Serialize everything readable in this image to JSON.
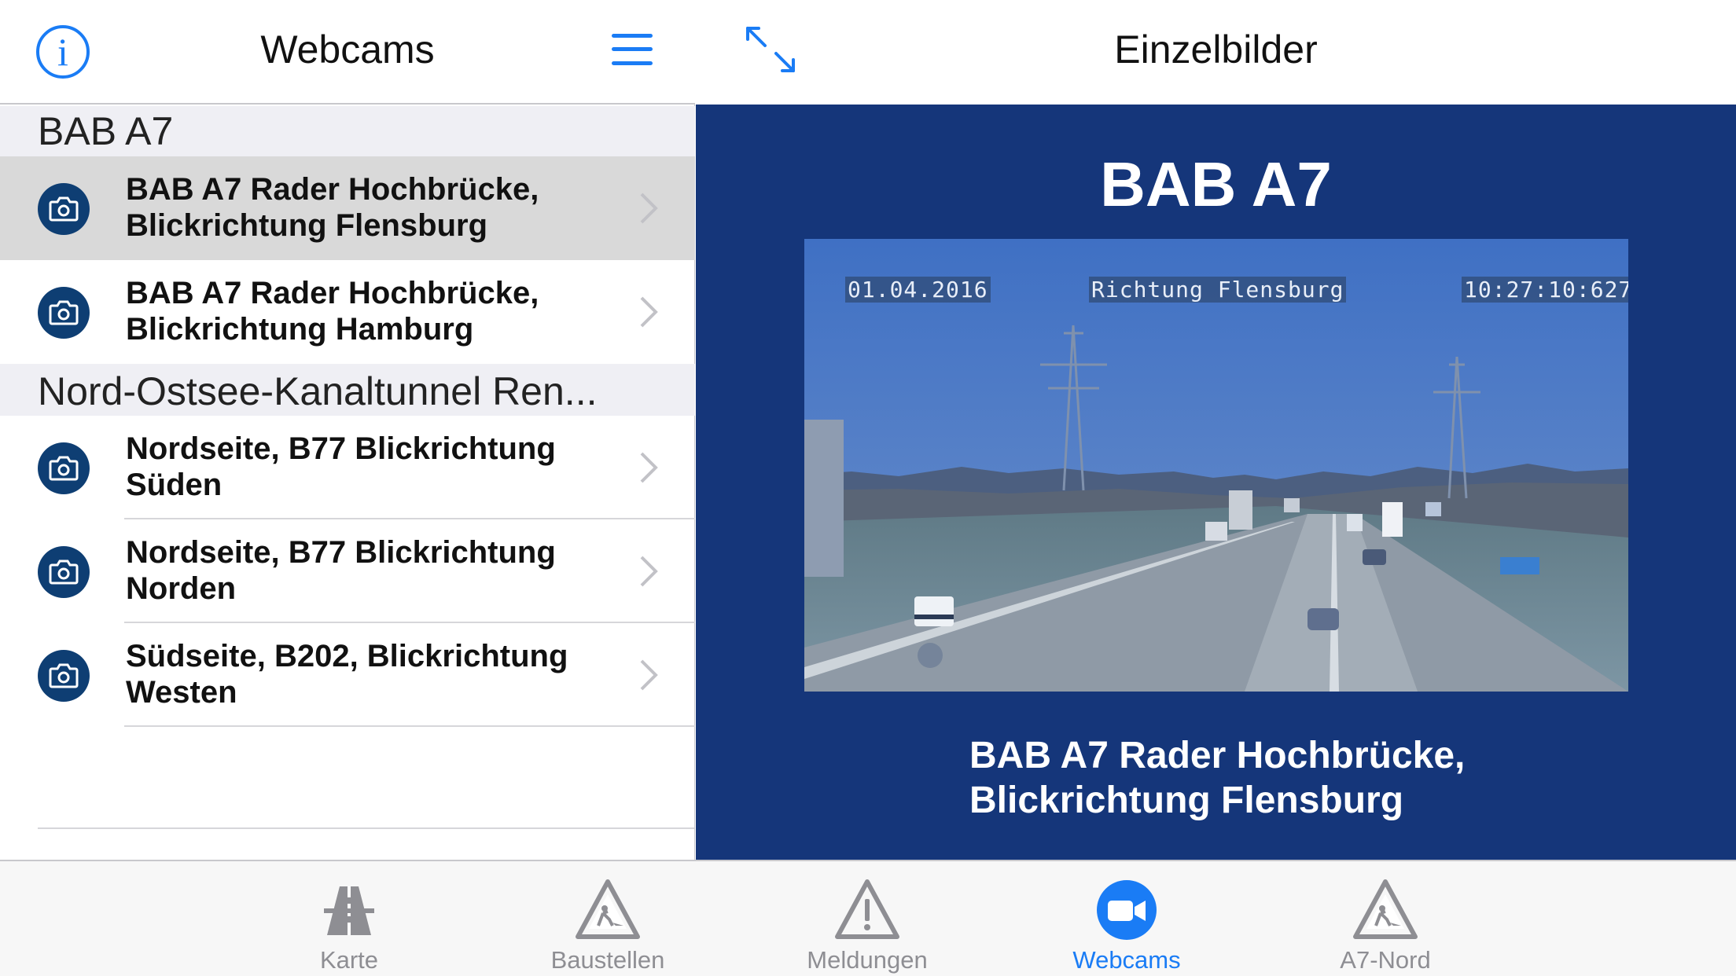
{
  "left_panel": {
    "title": "Webcams",
    "sections": [
      {
        "title": "BAB A7",
        "items": [
          {
            "label": "BAB A7 Rader Hochbrücke, Blickrichtung Flensburg",
            "selected": true
          },
          {
            "label": "BAB A7 Rader Hochbrücke, Blickrichtung Hamburg",
            "selected": false
          }
        ]
      },
      {
        "title": "Nord-Ostsee-Kanaltunnel Ren...",
        "items": [
          {
            "label": "Nordseite, B77 Blickrichtung Süden",
            "selected": false
          },
          {
            "label": "Nordseite, B77 Blickrichtung Norden",
            "selected": false
          },
          {
            "label": "Südseite, B202, Blickrichtung Westen",
            "selected": false
          }
        ]
      }
    ]
  },
  "right_panel": {
    "title": "Einzelbilder",
    "heading": "BAB A7",
    "camera": {
      "date": "01.04.2016",
      "direction": "Richtung Flensburg",
      "time": "10:27:10:627"
    },
    "caption": "BAB A7 Rader Hochbrücke, Blickrichtung Flensburg"
  },
  "tabs": [
    {
      "label": "Karte",
      "icon": "highway-icon",
      "active": false
    },
    {
      "label": "Baustellen",
      "icon": "roadworks-icon",
      "active": false
    },
    {
      "label": "Meldungen",
      "icon": "warning-icon",
      "active": false
    },
    {
      "label": "Webcams",
      "icon": "video-camera-icon",
      "active": true
    },
    {
      "label": "A7-Nord",
      "icon": "roadworks-icon",
      "active": false
    }
  ],
  "colors": {
    "accent": "#1a7cf5",
    "content_background": "#15367a",
    "camera_badge": "#0e3e73",
    "selected_row": "#d9d9d9",
    "section_background": "#efeff4",
    "inactive_tab": "#8e8e93"
  }
}
